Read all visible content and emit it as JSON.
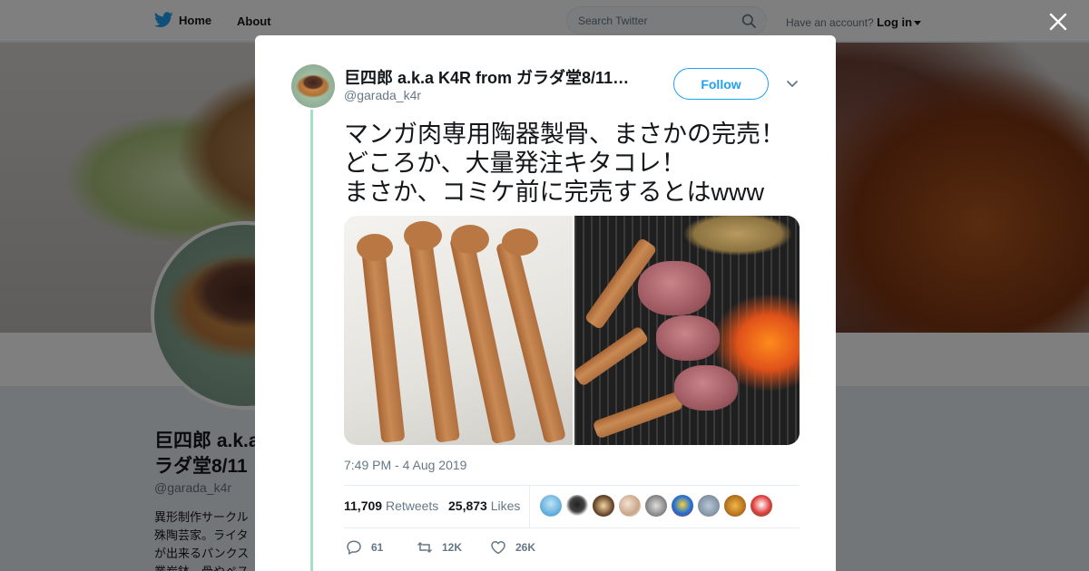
{
  "nav": {
    "home_label": "Home",
    "about_label": "About",
    "search_placeholder": "Search Twitter",
    "account_prompt": "Have an account?",
    "login_label": "Log in"
  },
  "profile_background": {
    "name": "巨四郎 a.k.a\nラダ堂8/11",
    "handle": "@garada_k4r",
    "bio": "異形制作サークル\n殊陶芸家。ライタ\nが出来るパンクス\n業炭鉢。骨やペス"
  },
  "tweet": {
    "author_name": "巨四郎 a.k.a K4R from ガラダ堂8/11…",
    "author_handle": "@garada_k4r",
    "follow_label": "Follow",
    "text": "マンガ肉専用陶器製骨、まさかの完売！\nどころか、大量発注キタコレ！\nまさか、コミケ前に完売するとはwww",
    "timestamp": "7:49 PM - 4 Aug 2019",
    "retweets_count": "11,709",
    "retweets_label": "Retweets",
    "likes_count": "25,873",
    "likes_label": "Likes",
    "reply_count": "61",
    "retweet_count_short": "12K",
    "like_count_short": "26K"
  },
  "colors": {
    "twitter_blue": "#1da1f2",
    "thread_line": "#a3e1c6",
    "secondary_text": "#657786"
  },
  "icons": [
    "twitter-bird-icon",
    "search-icon",
    "caret-icon",
    "close-icon",
    "chevron-down-icon",
    "reply-icon",
    "retweet-icon",
    "like-icon"
  ]
}
